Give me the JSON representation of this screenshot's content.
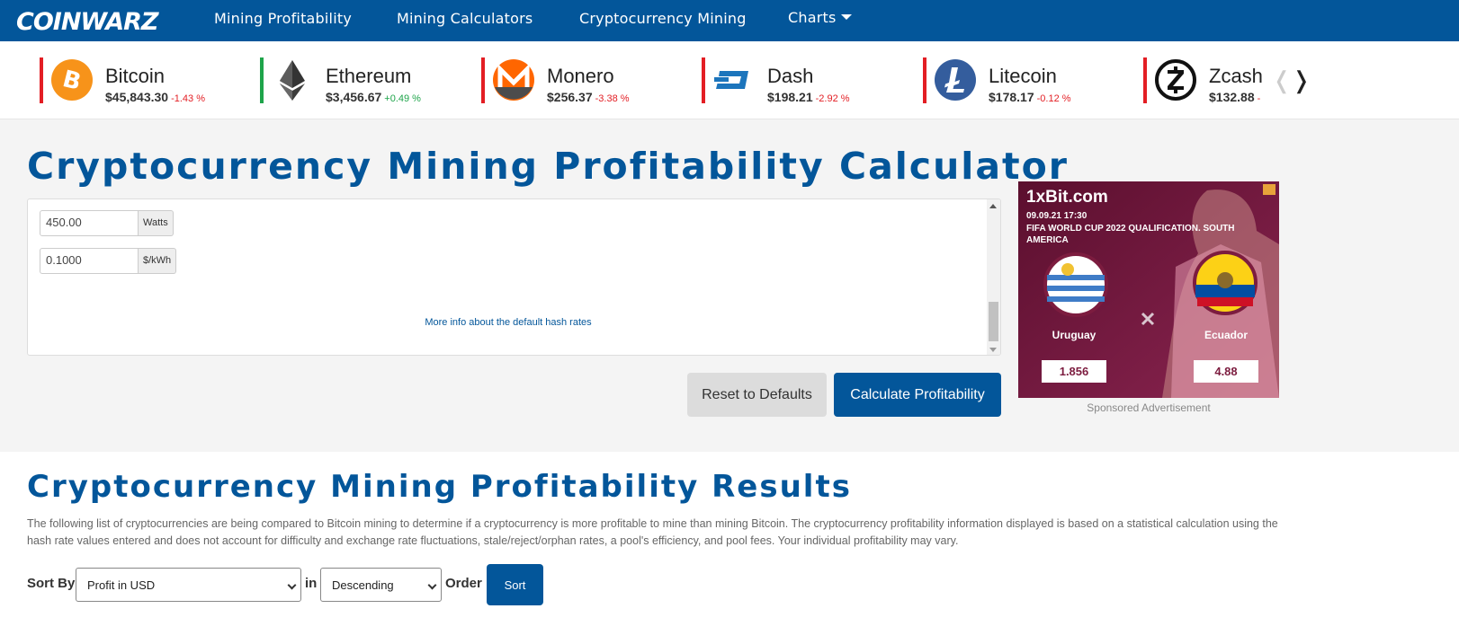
{
  "brand": {
    "logo_text": "COINWARZ",
    "color": "#03569a"
  },
  "nav": {
    "items": [
      {
        "label": "Mining Profitability"
      },
      {
        "label": "Mining Calculators"
      },
      {
        "label": "Cryptocurrency Mining"
      },
      {
        "label": "Charts"
      }
    ]
  },
  "ticker": {
    "coins": [
      {
        "name": "Bitcoin",
        "price": "$45,843.30",
        "change": "-1.43 %",
        "trend": "down",
        "icon": "bitcoin-icon"
      },
      {
        "name": "Ethereum",
        "price": "$3,456.67",
        "change": "+0.49 %",
        "trend": "up",
        "icon": "ethereum-icon"
      },
      {
        "name": "Monero",
        "price": "$256.37",
        "change": "-3.38 %",
        "trend": "down",
        "icon": "monero-icon"
      },
      {
        "name": "Dash",
        "price": "$198.21",
        "change": "-2.92 %",
        "trend": "down",
        "icon": "dash-icon"
      },
      {
        "name": "Litecoin",
        "price": "$178.17",
        "change": "-0.12 %",
        "trend": "down",
        "icon": "litecoin-icon"
      },
      {
        "name": "Zcash",
        "price": "$132.88",
        "change": "-",
        "trend": "down",
        "icon": "zcash-icon"
      }
    ],
    "prev_glyph": "❬",
    "next_glyph": "❭"
  },
  "calculator": {
    "title": "Cryptocurrency Mining Profitability Calculator",
    "power": {
      "value": "450.00",
      "unit": "Watts"
    },
    "cost": {
      "value": "0.1000",
      "unit": "$/kWh"
    },
    "more_info": "More info about the default hash rates",
    "reset_label": "Reset to Defaults",
    "calculate_label": "Calculate Profitability"
  },
  "ad": {
    "brand": "1xBit.com",
    "date": "09.09.21 17:30",
    "event": "FIFA WORLD CUP 2022 QUALIFICATION. SOUTH AMERICA",
    "team1": "Uruguay",
    "team2": "Ecuador",
    "odds1": "1.856",
    "odds2": "4.88",
    "caption": "Sponsored Advertisement"
  },
  "results": {
    "title": "Cryptocurrency Mining Profitability Results",
    "description": "The following list of cryptocurrencies are being compared to Bitcoin mining to determine if a cryptocurrency is more profitable to mine than mining Bitcoin. The cryptocurrency profitability information displayed is based on a statistical calculation using the hash rate values entered and does not account for difficulty and exchange rate fluctuations, stale/reject/orphan rates, a pool's efficiency, and pool fees. Your individual profitability may vary.",
    "sort_by_label": "Sort By",
    "sort_by_value": "Profit in USD",
    "in_label": "in",
    "order_value": "Descending",
    "order_label": "Order",
    "sort_button": "Sort"
  },
  "colors": {
    "negative": "#e31e24",
    "positive": "#1ea44a",
    "accent": "#03569a"
  }
}
